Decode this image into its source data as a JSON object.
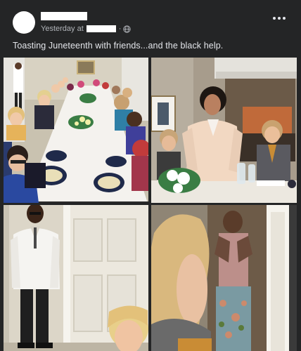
{
  "post": {
    "meta": {
      "time_label": "Yesterday at"
    },
    "caption": "Toasting Juneteenth with friends...and the black help.",
    "icons": {
      "more": "more-options-icon",
      "audience": "globe-icon"
    },
    "photos": [
      {
        "id": "dinner-table-wide"
      },
      {
        "id": "speaker-standing"
      },
      {
        "id": "server-in-white-jacket"
      },
      {
        "id": "staff-in-doorway"
      }
    ]
  }
}
